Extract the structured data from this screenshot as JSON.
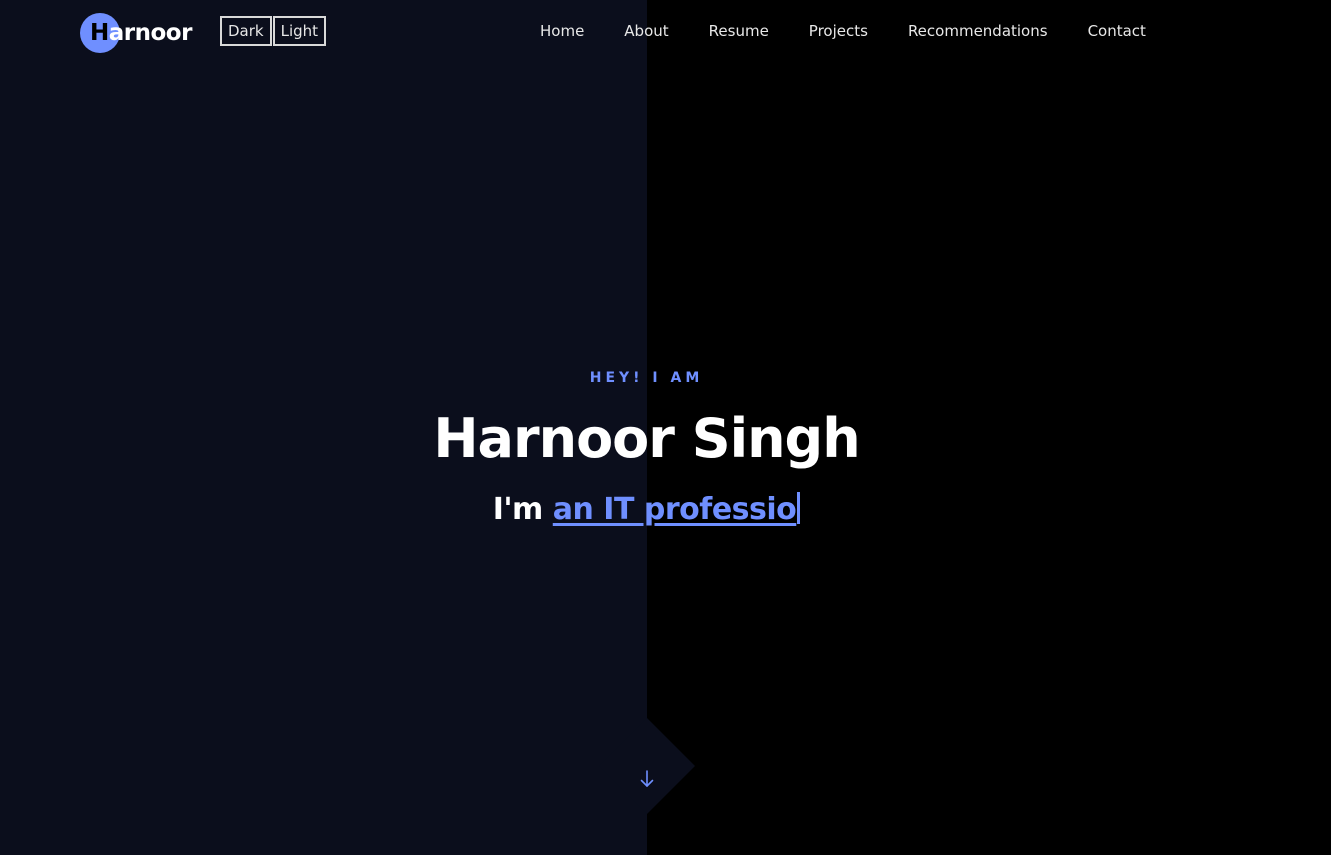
{
  "header": {
    "logo_first_letter": "H",
    "logo_rest": "arnoor",
    "theme_dark_label": "Dark",
    "theme_light_label": "Light",
    "nav": [
      {
        "label": "Home"
      },
      {
        "label": "About"
      },
      {
        "label": "Resume"
      },
      {
        "label": "Projects"
      },
      {
        "label": "Recommendations"
      },
      {
        "label": "Contact"
      }
    ]
  },
  "hero": {
    "eyebrow": "HEY! I AM",
    "name": "Harnoor Singh",
    "tagline_prefix": "I'm ",
    "tagline_typed": "an IT professio",
    "scroll_icon": "arrow-down-icon"
  },
  "colors": {
    "accent": "#6f8fff",
    "left_panel": "#0b0e1c",
    "right_panel": "#000000",
    "text": "#ffffff"
  }
}
